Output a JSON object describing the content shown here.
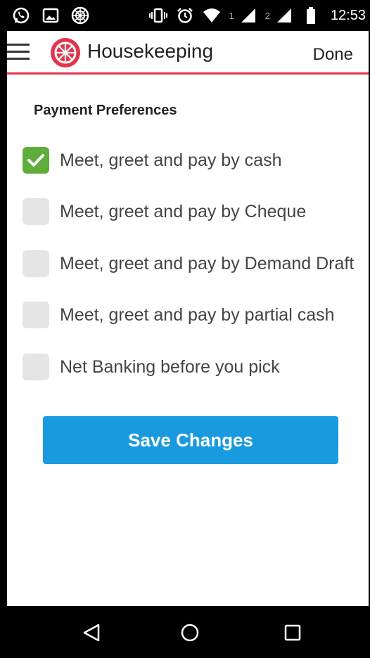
{
  "status_bar": {
    "left_icons": [
      "whatsapp-icon",
      "gallery-icon",
      "app-wheel-icon"
    ],
    "right_icons": [
      "vibrate-icon",
      "alarm-icon",
      "wifi-icon",
      "signal-sim1-icon",
      "signal-sim2-icon",
      "battery-icon"
    ],
    "sim1_label": "1",
    "sim2_label": "2",
    "time": "12:53"
  },
  "app_bar": {
    "title": "Housekeeping",
    "done_label": "Done",
    "accent_color": "#e3334b"
  },
  "payment": {
    "section_title": "Payment Preferences",
    "options": [
      {
        "label": "Meet, greet and pay by cash",
        "checked": true
      },
      {
        "label": "Meet, greet and pay by Cheque",
        "checked": false
      },
      {
        "label": "Meet, greet and pay by Demand Draft",
        "checked": false
      },
      {
        "label": "Meet, greet and pay by partial cash",
        "checked": false
      },
      {
        "label": "Net Banking before you pick",
        "checked": false
      }
    ],
    "checked_color": "#5fae3d"
  },
  "save_button": {
    "label": "Save Changes",
    "color": "#1a9ade"
  },
  "nav_bar": {
    "buttons": [
      "back-icon",
      "home-icon",
      "recents-icon"
    ]
  }
}
